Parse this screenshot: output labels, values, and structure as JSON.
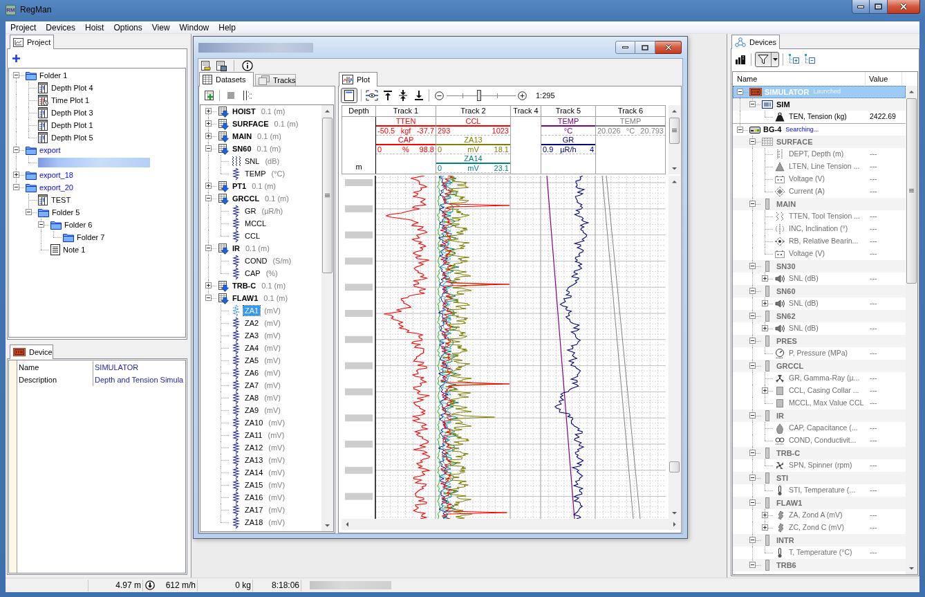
{
  "window": {
    "logo_text": "RM",
    "title": "RegMan"
  },
  "menu": [
    "Project",
    "Devices",
    "Hoist",
    "Options",
    "View",
    "Window",
    "Help"
  ],
  "project_panel": {
    "tab": {
      "label": "Project",
      "selected": true
    },
    "tree": [
      {
        "kind": "folder",
        "label": "Folder 1",
        "expanded": true,
        "selected": false,
        "children": [
          {
            "kind": "depth_plot",
            "label": "Depth Plot 4",
            "selected": false
          },
          {
            "kind": "time_plot",
            "label": "Time Plot 1",
            "selected": false
          },
          {
            "kind": "depth_plot",
            "label": "Depth Plot 3",
            "selected": false
          },
          {
            "kind": "depth_plot",
            "label": "Depth Plot 1",
            "selected": false
          },
          {
            "kind": "depth_plot",
            "label": "Depth Plot 5",
            "selected": false
          }
        ]
      },
      {
        "kind": "export_folder",
        "label": "export",
        "expanded": true,
        "selected": false,
        "children": [
          {
            "kind": "redacted",
            "selected": false
          }
        ]
      },
      {
        "kind": "export_folder",
        "label": "export_18",
        "expanded": false,
        "selected": false
      },
      {
        "kind": "export_folder",
        "label": "export_20",
        "expanded": true,
        "selected": false,
        "children": [
          {
            "kind": "depth_plot",
            "label": "TEST",
            "selected": false
          },
          {
            "kind": "folder",
            "label": "Folder 5",
            "expanded": true,
            "selected": false,
            "children": [
              {
                "kind": "folder",
                "label": "Folder 6",
                "expanded": true,
                "selected": false,
                "children": [
                  {
                    "kind": "folder",
                    "label": "Folder 7",
                    "selected": false
                  }
                ]
              },
              {
                "kind": "note",
                "label": "Note 1",
                "selected": false
              }
            ]
          }
        ]
      }
    ]
  },
  "device_panel": {
    "tab": {
      "label": "Device",
      "selected": true
    },
    "properties": [
      {
        "name": "Name",
        "value": "SIMULATOR"
      },
      {
        "name": "Description",
        "value": "Depth and Tension Simula"
      }
    ]
  },
  "plot_window": {
    "tabs": [
      {
        "label": "Datasets",
        "selected": true
      },
      {
        "label": "Tracks",
        "selected": false
      }
    ],
    "datasets": [
      {
        "kind": "dataset",
        "name": "HOIST",
        "detail": "0.1 (m)",
        "expanded": false,
        "selected": false
      },
      {
        "kind": "dataset",
        "name": "SURFACE",
        "detail": "0.1 (m)",
        "expanded": false,
        "selected": false
      },
      {
        "kind": "dataset",
        "name": "MAIN",
        "detail": "0.1 (m)",
        "expanded": false,
        "selected": false
      },
      {
        "kind": "dataset",
        "name": "SN60",
        "detail": "0.1 (m)",
        "expanded": true,
        "selected": false,
        "children": [
          {
            "kind": "spectrum",
            "name": "SNL",
            "detail": "(dB)",
            "selected": false
          },
          {
            "kind": "curve",
            "name": "TEMP",
            "detail": "(°C)",
            "selected": false
          }
        ]
      },
      {
        "kind": "dataset",
        "name": "PT1",
        "detail": "0.1 (m)",
        "expanded": false,
        "selected": false
      },
      {
        "kind": "dataset",
        "name": "GRCCL",
        "detail": "0.1 (m)",
        "expanded": true,
        "selected": false,
        "children": [
          {
            "kind": "curve",
            "name": "GR",
            "detail": "(µR/h)",
            "selected": false
          },
          {
            "kind": "curve",
            "name": "MCCL",
            "selected": false
          },
          {
            "kind": "curve",
            "name": "CCL",
            "selected": false
          }
        ]
      },
      {
        "kind": "dataset",
        "name": "IR",
        "detail": "0.1 (m)",
        "expanded": true,
        "selected": false,
        "children": [
          {
            "kind": "curve",
            "name": "COND",
            "detail": "(S/m)",
            "selected": false
          },
          {
            "kind": "curve",
            "name": "CAP",
            "detail": "(%)",
            "selected": false
          }
        ]
      },
      {
        "kind": "dataset",
        "name": "TRB-C",
        "detail": "0.1 (m)",
        "expanded": false,
        "selected": false
      },
      {
        "kind": "dataset",
        "name": "FLAW1",
        "detail": "0.1 (m)",
        "expanded": true,
        "selected": false,
        "children": [
          {
            "kind": "curve",
            "name": "ZA1",
            "detail": "(mV)",
            "selected": true
          },
          {
            "kind": "curve",
            "name": "ZA2",
            "detail": "(mV)",
            "selected": false
          },
          {
            "kind": "curve",
            "name": "ZA3",
            "detail": "(mV)",
            "selected": false
          },
          {
            "kind": "curve",
            "name": "ZA4",
            "detail": "(mV)",
            "selected": false
          },
          {
            "kind": "curve",
            "name": "ZA5",
            "detail": "(mV)",
            "selected": false
          },
          {
            "kind": "curve",
            "name": "ZA6",
            "detail": "(mV)",
            "selected": false
          },
          {
            "kind": "curve",
            "name": "ZA7",
            "detail": "(mV)",
            "selected": false
          },
          {
            "kind": "curve",
            "name": "ZA8",
            "detail": "(mV)",
            "selected": false
          },
          {
            "kind": "curve",
            "name": "ZA9",
            "detail": "(mV)",
            "selected": false
          },
          {
            "kind": "curve",
            "name": "ZA10",
            "detail": "(mV)",
            "selected": false
          },
          {
            "kind": "curve",
            "name": "ZA11",
            "detail": "(mV)",
            "selected": false
          },
          {
            "kind": "curve",
            "name": "ZA12",
            "detail": "(mV)",
            "selected": false
          },
          {
            "kind": "curve",
            "name": "ZA13",
            "detail": "(mV)",
            "selected": false
          },
          {
            "kind": "curve",
            "name": "ZA14",
            "detail": "(mV)",
            "selected": false
          },
          {
            "kind": "curve",
            "name": "ZA15",
            "detail": "(mV)",
            "selected": false
          },
          {
            "kind": "curve",
            "name": "ZA16",
            "detail": "(mV)",
            "selected": false
          },
          {
            "kind": "curve",
            "name": "ZA17",
            "detail": "(mV)",
            "selected": false
          },
          {
            "kind": "curve",
            "name": "ZA18",
            "detail": "(mV)",
            "selected": false
          }
        ]
      }
    ],
    "plot_tab": {
      "label": "Plot",
      "selected": true
    },
    "layout_toggle_pressed": true,
    "zoom": {
      "level": 0.47,
      "scale": "1:295"
    },
    "tracks": [
      {
        "kind": "depth",
        "title": "Depth",
        "unit": "m"
      },
      {
        "kind": "track",
        "title": "Track 1",
        "curves": [
          {
            "name": "TTEN",
            "color": "#ff0000",
            "min": "-50.5",
            "unit": "kgf",
            "max": "-37.7"
          },
          {
            "name": "CAP",
            "color": "#ff0000",
            "min": "0",
            "unit": "%",
            "max": "98.8"
          }
        ]
      },
      {
        "kind": "track",
        "title": "Track 2",
        "curves": [
          {
            "name": "CCL",
            "color": "#ff0000",
            "min": "293",
            "max": "1023"
          },
          {
            "name": "ZA13",
            "color": "#808000",
            "min": "0",
            "unit": "mV",
            "max": "18.1"
          },
          {
            "name": "ZA14",
            "color": "#008080",
            "min": "0",
            "unit": "mV",
            "max": "23.1"
          }
        ]
      },
      {
        "kind": "track",
        "title": "Track 4"
      },
      {
        "kind": "track",
        "title": "Track 5",
        "curves": [
          {
            "name": "TEMP",
            "color": "#800080",
            "unit": "°C"
          },
          {
            "name": "GR",
            "color": "#000080",
            "min": "0.9",
            "unit": "µR/h",
            "max": "4"
          }
        ]
      },
      {
        "kind": "track",
        "title": "Track 6",
        "curves": [
          {
            "name": "TEMP",
            "color": "#808080",
            "min": "20.026",
            "unit": "°C",
            "max": "20.793"
          }
        ]
      }
    ]
  },
  "devices_panel": {
    "tab": {
      "label": "Devices",
      "selected": true
    },
    "filter_pressed": true,
    "columns": [
      "Name",
      "Value"
    ],
    "devices": [
      {
        "kind": "simulator",
        "name": "SIMULATOR",
        "status": "Launched",
        "active": true,
        "selected": true,
        "expanded": true,
        "children": [
          {
            "kind": "simulator_module",
            "name": "SIM",
            "selected": false,
            "expanded": true,
            "children": [
              {
                "kind": "tension",
                "name": "TEN, Tension (kg)",
                "value": "2422.69",
                "selected": false
              }
            ]
          }
        ]
      },
      {
        "kind": "tool",
        "name": "BG-4",
        "status": "Searching...",
        "active": false,
        "selected": false,
        "expanded": true,
        "children": [
          {
            "kind": "surface_module",
            "name": "SURFACE",
            "selected": false,
            "expanded": true,
            "children": [
              {
                "kind": "depth",
                "name": "DEPT, Depth (m)",
                "value": "---",
                "selected": false
              },
              {
                "kind": "line_tension",
                "name": "LTEN, Line Tension ...",
                "value": "---",
                "selected": false
              },
              {
                "kind": "voltage",
                "name": "Voltage (V)",
                "value": "---",
                "selected": false
              },
              {
                "kind": "current",
                "name": "Current (A)",
                "value": "---",
                "selected": false
              }
            ]
          },
          {
            "kind": "downhole_module",
            "name": "MAIN",
            "selected": false,
            "expanded": true,
            "children": [
              {
                "kind": "tool_tension",
                "name": "TTEN, Tool Tension ...",
                "value": "---",
                "selected": false
              },
              {
                "kind": "inclination",
                "name": "INC, Inclination (°)",
                "value": "---",
                "selected": false
              },
              {
                "kind": "bearing",
                "name": "RB, Relative Bearin...",
                "value": "---",
                "selected": false
              },
              {
                "kind": "voltage",
                "name": "Voltage (V)",
                "value": "---",
                "selected": false
              }
            ]
          },
          {
            "kind": "downhole_module",
            "name": "SN30",
            "selected": false,
            "expanded": true,
            "children": [
              {
                "kind": "sound",
                "name": "SNL (dB)",
                "value": "---",
                "selected": false,
                "expanded": false
              }
            ]
          },
          {
            "kind": "downhole_module",
            "name": "SN60",
            "selected": false,
            "expanded": true,
            "children": [
              {
                "kind": "sound",
                "name": "SNL (dB)",
                "value": "---",
                "selected": false,
                "expanded": false
              }
            ]
          },
          {
            "kind": "downhole_module",
            "name": "SN62",
            "selected": false,
            "expanded": true,
            "children": [
              {
                "kind": "sound",
                "name": "SNL (dB)",
                "value": "---",
                "selected": false,
                "expanded": false
              }
            ]
          },
          {
            "kind": "downhole_module",
            "name": "PRES",
            "selected": false,
            "expanded": true,
            "children": [
              {
                "kind": "pressure",
                "name": "P, Pressure (MPa)",
                "value": "---",
                "selected": false
              }
            ]
          },
          {
            "kind": "downhole_module",
            "name": "GRCCL",
            "selected": false,
            "expanded": true,
            "children": [
              {
                "kind": "gamma",
                "name": "GR, Gamma-Ray (µ...",
                "value": "---",
                "selected": false
              },
              {
                "kind": "collar",
                "name": "CCL, Casing Collar ...",
                "value": "---",
                "selected": false,
                "expanded": false
              },
              {
                "kind": "collar",
                "name": "MCCL, Max Value CCL",
                "value": "---",
                "selected": false
              }
            ]
          },
          {
            "kind": "downhole_module",
            "name": "IR",
            "selected": false,
            "expanded": true,
            "children": [
              {
                "kind": "capacitance",
                "name": "CAP, Capacitance (...",
                "value": "---",
                "selected": false
              },
              {
                "kind": "conductivity",
                "name": "COND, Conductivit...",
                "value": "---",
                "selected": false
              }
            ]
          },
          {
            "kind": "downhole_module",
            "name": "TRB-C",
            "selected": false,
            "expanded": true,
            "children": [
              {
                "kind": "spinner",
                "name": "SPN, Spinner (rpm)",
                "value": "---",
                "selected": false
              }
            ]
          },
          {
            "kind": "downhole_module",
            "name": "STI",
            "selected": false,
            "expanded": true,
            "children": [
              {
                "kind": "temperature",
                "name": "STI, Temperature (...",
                "value": "---",
                "selected": false
              }
            ]
          },
          {
            "kind": "downhole_module",
            "name": "FLAW1",
            "selected": false,
            "expanded": true,
            "children": [
              {
                "kind": "probe",
                "name": "ZA, Zond A (mV)",
                "value": "---",
                "selected": false,
                "expanded": false
              },
              {
                "kind": "probe",
                "name": "ZC, Zond C (mV)",
                "value": "---",
                "selected": false,
                "expanded": false
              }
            ]
          },
          {
            "kind": "downhole_module",
            "name": "INTR",
            "selected": false,
            "expanded": true,
            "children": [
              {
                "kind": "temperature",
                "name": "T, Temperature (°C)",
                "value": "---",
                "selected": false
              }
            ]
          },
          {
            "kind": "downhole_module",
            "name": "TRB6",
            "selected": false,
            "expanded": true
          }
        ]
      }
    ]
  },
  "status_bar": {
    "depth": "4.97 m",
    "speed": "612 m/h",
    "load": "0 kg",
    "time": "8:18:06"
  }
}
